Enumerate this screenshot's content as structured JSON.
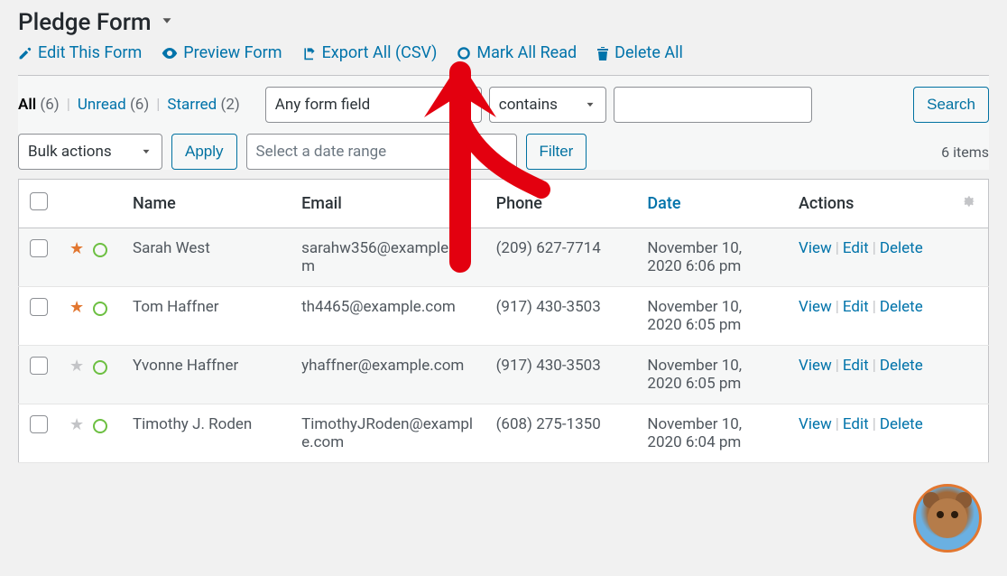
{
  "header": {
    "title": "Pledge Form"
  },
  "toolbar": {
    "edit": "Edit This Form",
    "preview": "Preview Form",
    "export": "Export All (CSV)",
    "markread": "Mark All Read",
    "deleteall": "Delete All"
  },
  "subsub": {
    "all_label": "All",
    "all_count": "(6)",
    "unread_label": "Unread",
    "unread_count": "(6)",
    "starred_label": "Starred",
    "starred_count": "(2)"
  },
  "filters": {
    "field_select": "Any form field",
    "condition_select": "contains",
    "search_value": "",
    "search_button": "Search",
    "bulk_select": "Bulk actions",
    "apply_button": "Apply",
    "date_placeholder": "Select a date range",
    "filter_button": "Filter",
    "items_count": "6 items"
  },
  "columns": {
    "name": "Name",
    "email": "Email",
    "phone": "Phone",
    "date": "Date",
    "actions": "Actions"
  },
  "action_labels": {
    "view": "View",
    "edit": "Edit",
    "delete": "Delete"
  },
  "rows": [
    {
      "starred": true,
      "name": "Sarah West",
      "email": "sarahw356@example.com",
      "phone": "(209) 627-7714",
      "date": "November 10, 2020 6:06 pm"
    },
    {
      "starred": true,
      "name": "Tom Haffner",
      "email": "th4465@example.com",
      "phone": "(917) 430-3503",
      "date": "November 10, 2020 6:05 pm"
    },
    {
      "starred": false,
      "name": "Yvonne Haffner",
      "email": "yhaffner@example.com",
      "phone": "(917) 430-3503",
      "date": "November 10, 2020 6:05 pm"
    },
    {
      "starred": false,
      "name": "Timothy J. Roden",
      "email": "TimothyJRoden@example.com",
      "phone": "(608) 275-1350",
      "date": "November 10, 2020 6:04 pm"
    }
  ],
  "icons": {
    "chevron_down": "chevron-down",
    "pencil": "pencil",
    "eye": "eye",
    "export": "export",
    "circle": "circle",
    "trash": "trash",
    "gear": "gear"
  }
}
